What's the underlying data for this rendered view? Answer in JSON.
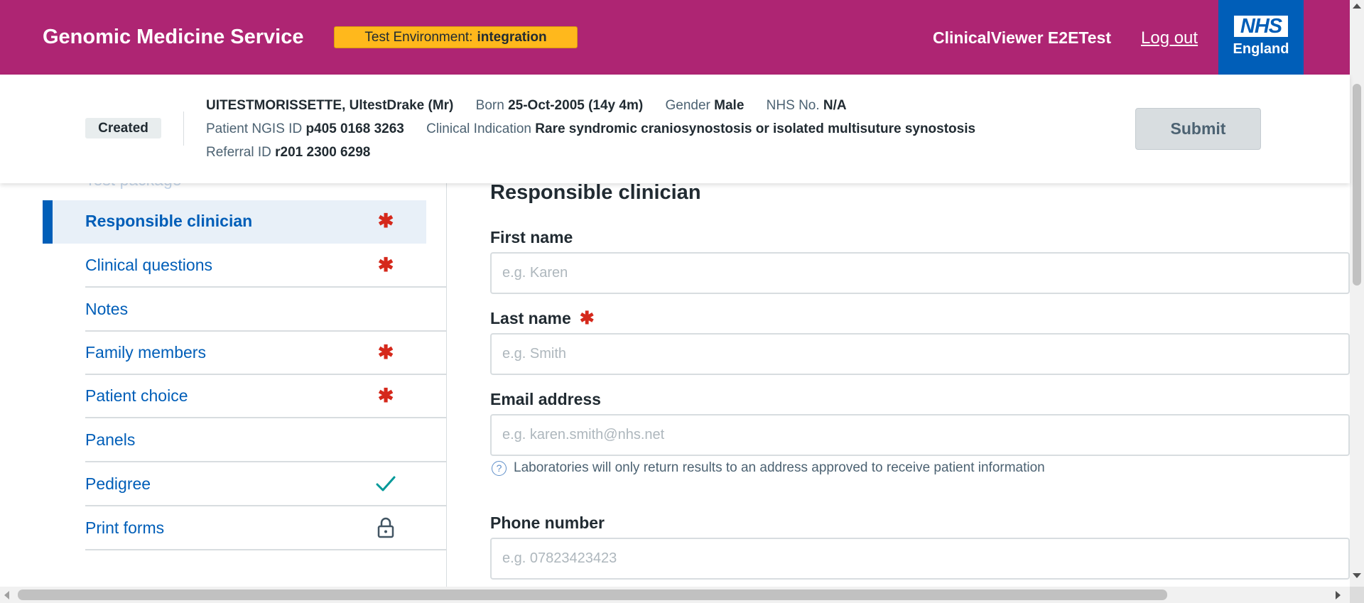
{
  "header": {
    "service_name": "Genomic Medicine Service",
    "env_label": "Test Environment:",
    "env_value": "integration",
    "user_name": "ClinicalViewer E2ETest",
    "logout_label": "Log out",
    "nhs_logo": "NHS",
    "nhs_region": "England",
    "colors": {
      "brand": "#ae2573",
      "env_badge": "#ffb81c",
      "nhs_blue": "#005eb8"
    }
  },
  "banner": {
    "status": "Created",
    "patient_name": "UITESTMORISSETTE, UltestDrake (Mr)",
    "born_label": "Born",
    "born_value": "25-Oct-2005 (14y 4m)",
    "gender_label": "Gender",
    "gender_value": "Male",
    "nhs_no_label": "NHS No.",
    "nhs_no_value": "N/A",
    "ngis_label": "Patient NGIS ID",
    "ngis_value": "p405 0168 3263",
    "indication_label": "Clinical Indication",
    "indication_value": "Rare syndromic craniosynostosis or isolated multisuture synostosis",
    "referral_label": "Referral ID",
    "referral_value": "r201 2300 6298",
    "submit_label": "Submit"
  },
  "nav": {
    "clipped_label": "Test package",
    "items": [
      {
        "label": "Responsible clinician",
        "marker": "required",
        "active": true
      },
      {
        "label": "Clinical questions",
        "marker": "required",
        "active": false
      },
      {
        "label": "Notes",
        "marker": "none",
        "active": false
      },
      {
        "label": "Family members",
        "marker": "required",
        "active": false
      },
      {
        "label": "Patient choice",
        "marker": "required",
        "active": false
      },
      {
        "label": "Panels",
        "marker": "none",
        "active": false
      },
      {
        "label": "Pedigree",
        "marker": "check-icon",
        "active": false
      },
      {
        "label": "Print forms",
        "marker": "lock-icon",
        "active": false
      }
    ],
    "required_symbol": "✱"
  },
  "form": {
    "title": "Responsible clinician",
    "first_name": {
      "label": "First name",
      "placeholder": "e.g. Karen",
      "value": ""
    },
    "last_name": {
      "label": "Last name",
      "placeholder": "e.g. Smith",
      "value": ""
    },
    "email": {
      "label": "Email address",
      "placeholder": "e.g. karen.smith@nhs.net",
      "value": ""
    },
    "email_hint": "Laboratories will only return results to an address approved to receive patient information",
    "hint_icon": "question-circle-icon",
    "phone": {
      "label": "Phone number",
      "placeholder": "e.g. 07823423423",
      "value": ""
    }
  }
}
